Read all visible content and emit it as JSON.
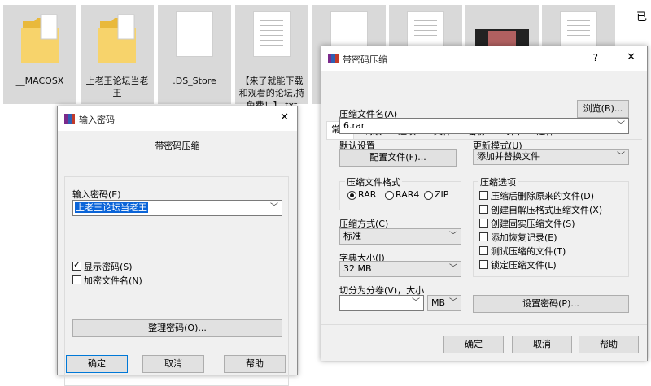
{
  "explorer": {
    "files": [
      {
        "name": "__MACOSX",
        "kind": "folder"
      },
      {
        "name": "上老王论坛当老王",
        "kind": "folder"
      },
      {
        "name": ".DS_Store",
        "kind": "doc"
      },
      {
        "name": "【来了就能下载和观看的论坛,持免费！】.txt",
        "kind": "doc"
      },
      {
        "name": "",
        "kind": "doc"
      },
      {
        "name": "",
        "kind": "doc"
      },
      {
        "name": "",
        "kind": "video"
      },
      {
        "name": "",
        "kind": "doc"
      }
    ],
    "side_text": "已"
  },
  "password_dialog": {
    "title": "输入密码",
    "close": "✕",
    "subtitle": "带密码压缩",
    "password_label": "输入密码(E)",
    "password_value": "上老王论坛当老王",
    "show_password": {
      "label": "显示密码(S)",
      "checked": true
    },
    "encrypt_names": {
      "label": "加密文件名(N)",
      "checked": false
    },
    "organize_button": "整理密码(O)...",
    "ok_button": "确定",
    "cancel_button": "取消",
    "help_button": "帮助"
  },
  "archive_dialog": {
    "title": "带密码压缩",
    "help_glyph": "?",
    "close": "✕",
    "tabs": [
      "常规",
      "高级",
      "选项",
      "文件",
      "备份",
      "时间",
      "注释"
    ],
    "archive_name_label": "压缩文件名(A)",
    "browse_button": "浏览(B)...",
    "archive_name_value": "6.rar",
    "default_settings_label": "默认设置",
    "profiles_button": "配置文件(F)...",
    "update_mode_label": "更新模式(U)",
    "update_mode_value": "添加并替换文件",
    "format_group": "压缩文件格式",
    "formats": [
      {
        "label": "RAR",
        "checked": true
      },
      {
        "label": "RAR4",
        "checked": false
      },
      {
        "label": "ZIP",
        "checked": false
      }
    ],
    "method_label": "压缩方式(C)",
    "method_value": "标准",
    "dict_label": "字典大小(I)",
    "dict_value": "32 MB",
    "split_label": "切分为分卷(V)，大小",
    "split_value": "",
    "split_unit": "MB",
    "options_group": "压缩选项",
    "options": [
      {
        "label": "压缩后删除原来的文件(D)",
        "checked": false
      },
      {
        "label": "创建自解压格式压缩文件(X)",
        "checked": false
      },
      {
        "label": "创建固实压缩文件(S)",
        "checked": false
      },
      {
        "label": "添加恢复记录(E)",
        "checked": false
      },
      {
        "label": "测试压缩的文件(T)",
        "checked": false
      },
      {
        "label": "锁定压缩文件(L)",
        "checked": false
      }
    ],
    "set_password_button": "设置密码(P)...",
    "ok_button": "确定",
    "cancel_button": "取消",
    "help_button": "帮助"
  }
}
